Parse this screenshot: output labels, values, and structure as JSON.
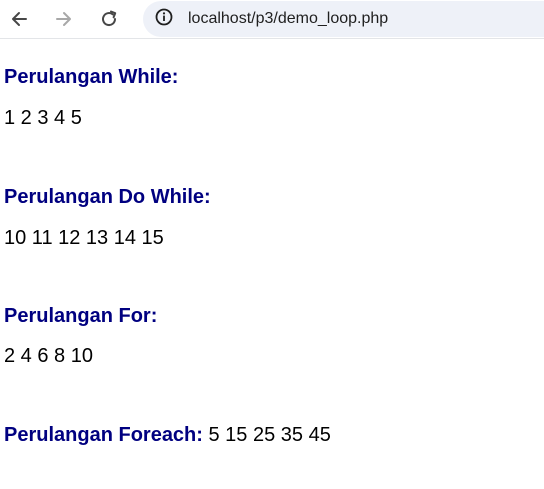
{
  "browser": {
    "url": "localhost/p3/demo_loop.php"
  },
  "icons": {
    "back": "arrow-left-icon",
    "forward": "arrow-right-icon",
    "reload": "reload-icon",
    "site_info": "info-circle-icon"
  },
  "colors": {
    "heading": "#000080",
    "text": "#000000",
    "omnibox_bg": "#eef1f8"
  },
  "sections": {
    "while": {
      "title": "Perulangan While:",
      "output": "1 2 3 4 5"
    },
    "do_while": {
      "title": "Perulangan Do While:",
      "output": "10 11 12 13 14 15"
    },
    "for": {
      "title": "Perulangan For:",
      "output": "2 4 6 8 10"
    },
    "foreach": {
      "title": "Perulangan Foreach:",
      "output": "5 15 25 35 45"
    }
  }
}
